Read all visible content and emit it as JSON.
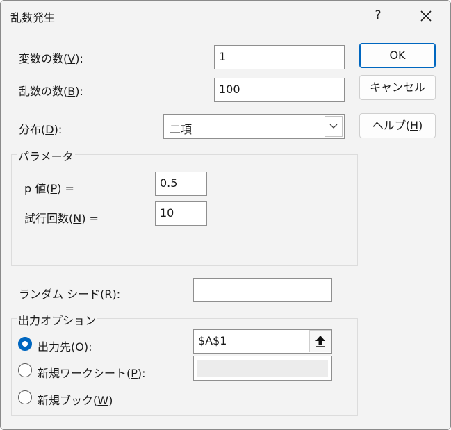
{
  "title": "乱数発生",
  "title_help": "?",
  "fields": {
    "num_variables": {
      "label_pre": "変数の数(",
      "accel": "V",
      "label_post": "):",
      "value": "1"
    },
    "num_random": {
      "label_pre": "乱数の数(",
      "accel": "B",
      "label_post": "):",
      "value": "100"
    },
    "distribution": {
      "label_pre": "分布(",
      "accel": "D",
      "label_post": "):",
      "value": "二項"
    }
  },
  "buttons": {
    "ok": "OK",
    "cancel": "キャンセル",
    "help": "ヘルプ(H)",
    "help_pre": "ヘルプ(",
    "help_accel": "H",
    "help_post": ")"
  },
  "parameters": {
    "legend": "パラメータ",
    "p_value": {
      "label_pre": "p 値(",
      "accel": "P",
      "label_post": ") =",
      "value": "0.5"
    },
    "trials": {
      "label_pre": "試行回数(",
      "accel": "N",
      "label_post": ") =",
      "value": "10"
    }
  },
  "seed": {
    "label_pre": "ランダム シード(",
    "accel": "R",
    "label_post": "):",
    "value": ""
  },
  "output": {
    "legend": "出力オプション",
    "range": {
      "label_pre": "出力先(",
      "accel": "O",
      "label_post": "):",
      "value": "$A$1",
      "checked": true
    },
    "new_sheet": {
      "label_pre": "新規ワークシート(",
      "accel": "P",
      "label_post": "):",
      "value": "",
      "checked": false
    },
    "new_book": {
      "label_pre": "新規ブック(",
      "accel": "W",
      "label_post": ")",
      "checked": false
    }
  },
  "colors": {
    "accent": "#0067c0",
    "dialog_bg": "#f3f3f3"
  }
}
